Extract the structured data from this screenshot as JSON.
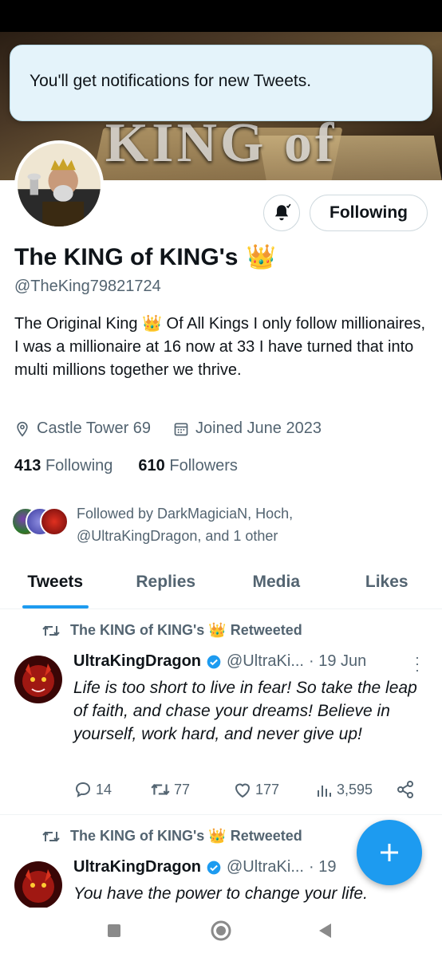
{
  "toast": {
    "text": "You'll get notifications for new Tweets."
  },
  "banner": {
    "title": "KING of KINGS"
  },
  "profile": {
    "name": "The KING of KING's",
    "crown_emoji": "👑",
    "handle": "@TheKing79821724",
    "bio": "The Original King 👑 Of All Kings  I only follow millionaires, I was a millionaire at 16 now at 33 I have turned that into multi millions together we thrive.",
    "location": "Castle Tower 69",
    "joined": "Joined June 2023",
    "following_count": "413",
    "following_label": "Following",
    "followers_count": "610",
    "followers_label": "Followers",
    "followed_by": "Followed by DarkMagiciaN, Hoch, @UltraKingDragon, and 1 other",
    "follow_button": "Following"
  },
  "tabs": [
    {
      "label": "Tweets",
      "active": true
    },
    {
      "label": "Replies",
      "active": false
    },
    {
      "label": "Media",
      "active": false
    },
    {
      "label": "Likes",
      "active": false
    }
  ],
  "tweets": [
    {
      "retweeted_by": "The KING of KING's 👑 Retweeted",
      "author": "UltraKingDragon",
      "handle": "@UltraKi...",
      "date": "· 19 Jun",
      "text": "Life is too short to live in fear! So take the leap of faith, and chase your dreams! Believe in yourself, work hard, and never give up!",
      "replies": "14",
      "retweets": "77",
      "likes": "177",
      "views": "3,595"
    },
    {
      "retweeted_by": "The KING of KING's 👑 Retweeted",
      "author": "UltraKingDragon",
      "handle": "@UltraKi...",
      "date": "· 19",
      "text": "You have the power to change your life."
    }
  ],
  "colors": {
    "accent": "#1d9bf0",
    "secondary_text": "#536471",
    "primary_text": "#0f1419"
  },
  "icons": [
    "bell-icon",
    "location-icon",
    "calendar-icon",
    "retweet-icon",
    "verified-icon",
    "reply-icon",
    "like-icon",
    "views-icon",
    "share-icon",
    "compose-plus-icon",
    "nav-square-icon",
    "nav-circle-icon",
    "nav-back-icon"
  ]
}
